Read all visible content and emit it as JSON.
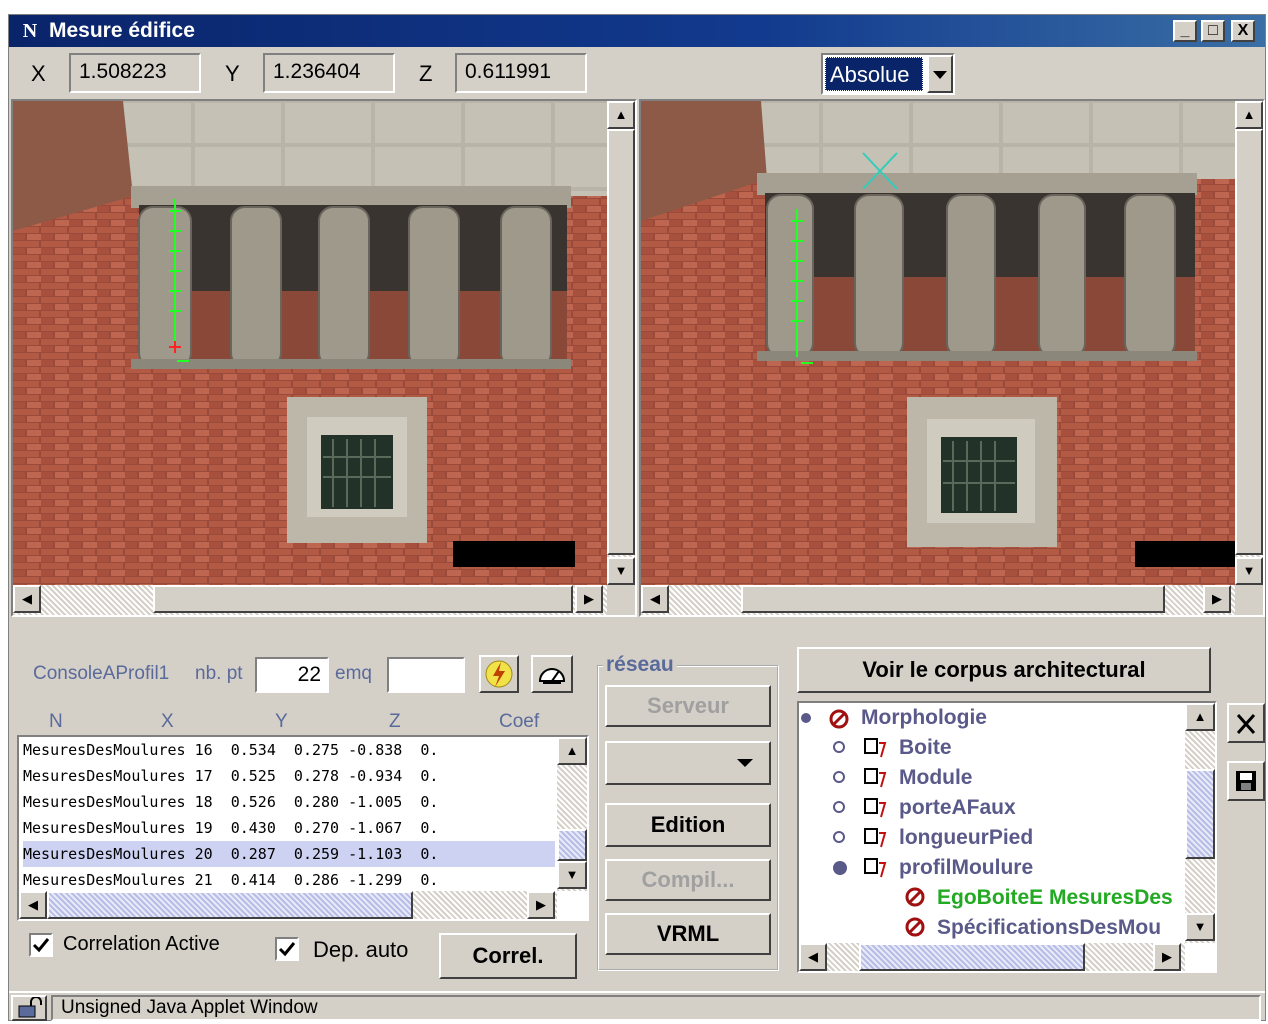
{
  "window": {
    "title": "Mesure édifice",
    "icon": "N",
    "minimize": "_",
    "maximize": "□",
    "close": "X"
  },
  "coords": {
    "x_label": "X",
    "x_value": "1.508223",
    "y_label": "Y",
    "y_value": "1.236404",
    "z_label": "Z",
    "z_value": "0.611991",
    "mode": "Absolue"
  },
  "console": {
    "name": "ConsoleAProfil1",
    "nbpt_label": "nb. pt",
    "nbpt_value": "22",
    "emq_label": "emq",
    "emq_value": ""
  },
  "table": {
    "columns": [
      "N",
      "X",
      "Y",
      "Z",
      "Coef"
    ],
    "rows": [
      "MesuresDesMoulures 16  0.534  0.275 -0.838  0.",
      "MesuresDesMoulures 17  0.525  0.278 -0.934  0.",
      "MesuresDesMoulures 18  0.526  0.280 -1.005  0.",
      "MesuresDesMoulures 19  0.430  0.270 -1.067  0.",
      "MesuresDesMoulures 20  0.287  0.259 -1.103  0.",
      "MesuresDesMoulures 21  0.414  0.286 -1.299  0."
    ],
    "selected_row": 4
  },
  "checks": {
    "correlation": "Correlation Active",
    "dep_auto": "Dep. auto",
    "correl_button": "Correl."
  },
  "reseau": {
    "legend": "réseau",
    "serveur": "Serveur",
    "edition": "Edition",
    "compil": "Compil...",
    "vrml": "VRML"
  },
  "corpus": {
    "button": "Voir le corpus architectural",
    "tree": [
      {
        "label": "Morphologie",
        "level": 0,
        "color": "#5a5a8a"
      },
      {
        "label": "Boite",
        "level": 1,
        "color": "#5a5a8a"
      },
      {
        "label": "Module",
        "level": 1,
        "color": "#5a5a8a"
      },
      {
        "label": "porteAFaux",
        "level": 1,
        "color": "#5a5a8a"
      },
      {
        "label": "longueurPied",
        "level": 1,
        "color": "#5a5a8a"
      },
      {
        "label": "profilMoulure",
        "level": 1,
        "color": "#5a5a8a"
      },
      {
        "label": "EgoBoiteE MesuresDes",
        "level": 2,
        "color": "#22aa22"
      },
      {
        "label": "SpécificationsDesMou",
        "level": 2,
        "color": "#5a5a8a"
      }
    ]
  },
  "status": {
    "text": "Unsigned Java Applet Window"
  }
}
